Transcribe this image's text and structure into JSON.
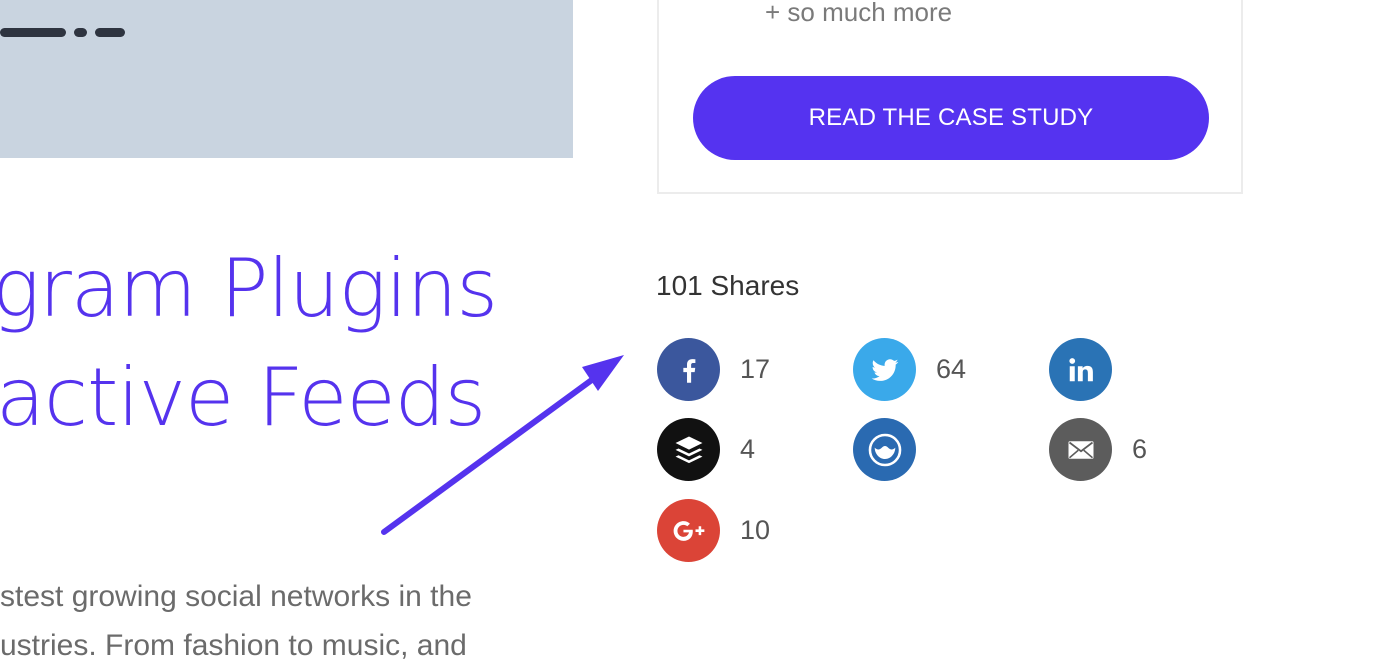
{
  "article": {
    "title_line_1": "gram Plugins",
    "title_line_2": "active Feeds",
    "body_line_1": "stest growing social networks in the",
    "body_line_2": "ustries. From fashion to music, and"
  },
  "promo": {
    "extra_text": "+ so much more",
    "cta_label": "READ THE CASE STUDY"
  },
  "shares": {
    "total_label": "101 Shares",
    "networks": [
      {
        "name": "facebook",
        "icon": "facebook-icon",
        "color": "#3b579d",
        "count": "17"
      },
      {
        "name": "twitter",
        "icon": "twitter-icon",
        "color": "#3aa9ea",
        "count": "64"
      },
      {
        "name": "linkedin",
        "icon": "linkedin-icon",
        "color": "#2a73b5",
        "count": ""
      },
      {
        "name": "buffer",
        "icon": "buffer-icon",
        "color": "#111111",
        "count": "4"
      },
      {
        "name": "hacker-news",
        "icon": "hacker-news-icon",
        "color": "#2a6ab1",
        "count": ""
      },
      {
        "name": "email",
        "icon": "email-icon",
        "color": "#5c5c5c",
        "count": "6"
      },
      {
        "name": "google-plus",
        "icon": "google-plus-icon",
        "color": "#db4437",
        "count": "10"
      }
    ]
  },
  "colors": {
    "accent": "#5533f0",
    "hero_bg": "#c9d4e0"
  }
}
